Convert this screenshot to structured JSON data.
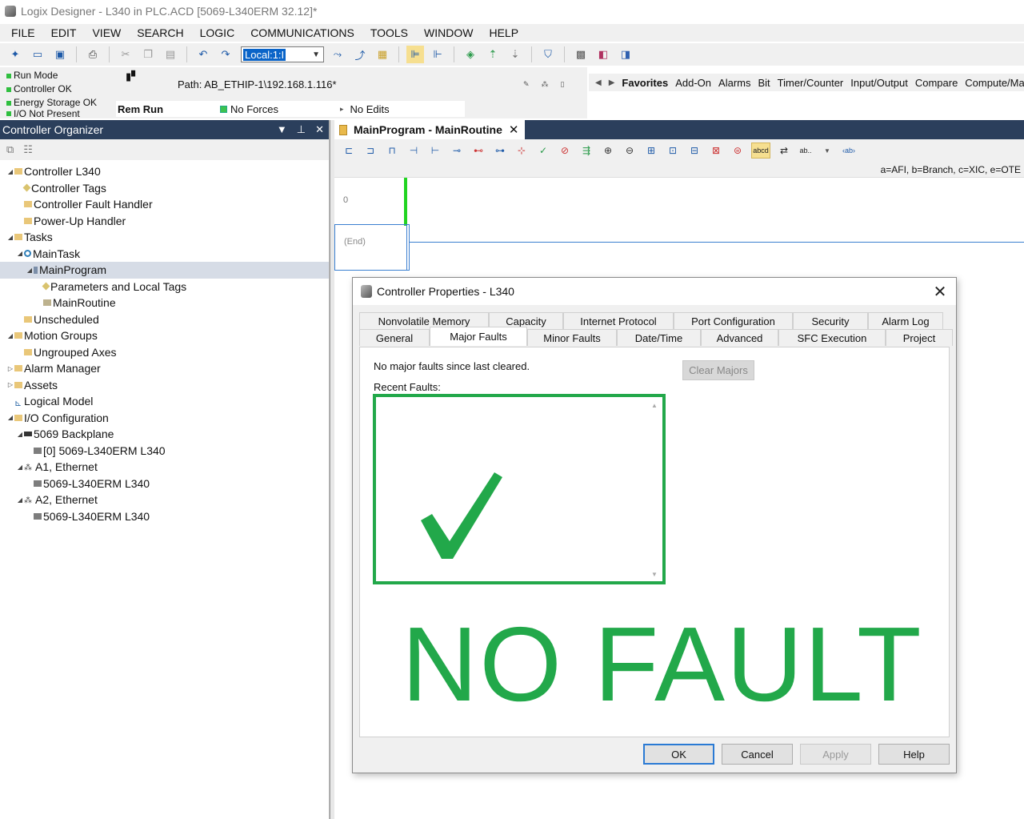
{
  "window": {
    "title": "Logix Designer - L340 in PLC.ACD [5069-L340ERM 32.12]*"
  },
  "menu": [
    "FILE",
    "EDIT",
    "VIEW",
    "SEARCH",
    "LOGIC",
    "COMMUNICATIONS",
    "TOOLS",
    "WINDOW",
    "HELP"
  ],
  "toolbar": {
    "path_combo_value": "Local:1:I"
  },
  "status": {
    "items": [
      "Run Mode",
      "Controller OK",
      "Energy Storage OK",
      "I/O Not Present"
    ],
    "path": "Path:  AB_ETHIP-1\\192.168.1.116*",
    "mode": "Rem Run",
    "forces": "No Forces",
    "edits": "No Edits"
  },
  "instruction_tabs": [
    "Favorites",
    "Add-On",
    "Alarms",
    "Bit",
    "Timer/Counter",
    "Input/Output",
    "Compare",
    "Compute/Math"
  ],
  "organizer": {
    "title": "Controller Organizer",
    "tree": [
      {
        "label": "Controller L340",
        "level": 0,
        "expander": "◢",
        "icon": "folder"
      },
      {
        "label": "Controller Tags",
        "level": 1,
        "expander": "",
        "icon": "tag"
      },
      {
        "label": "Controller Fault Handler",
        "level": 1,
        "expander": "",
        "icon": "folder"
      },
      {
        "label": "Power-Up Handler",
        "level": 1,
        "expander": "",
        "icon": "folder"
      },
      {
        "label": "Tasks",
        "level": 0,
        "expander": "◢",
        "icon": "folder"
      },
      {
        "label": "MainTask",
        "level": 1,
        "expander": "◢",
        "icon": "gear"
      },
      {
        "label": "MainProgram",
        "level": 2,
        "expander": "◢",
        "icon": "prog",
        "selected": true
      },
      {
        "label": "Parameters and Local Tags",
        "level": 3,
        "expander": "",
        "icon": "tag"
      },
      {
        "label": "MainRoutine",
        "level": 3,
        "expander": "",
        "icon": "routine"
      },
      {
        "label": "Unscheduled",
        "level": 1,
        "expander": "",
        "icon": "folder"
      },
      {
        "label": "Motion Groups",
        "level": 0,
        "expander": "◢",
        "icon": "folder"
      },
      {
        "label": "Ungrouped Axes",
        "level": 1,
        "expander": "",
        "icon": "folder"
      },
      {
        "label": "Alarm Manager",
        "level": 0,
        "expander": "▷",
        "icon": "folder"
      },
      {
        "label": "Assets",
        "level": 0,
        "expander": "▷",
        "icon": "folder"
      },
      {
        "label": "Logical Model",
        "level": 0,
        "expander": "",
        "icon": "model"
      },
      {
        "label": "I/O Configuration",
        "level": 0,
        "expander": "◢",
        "icon": "folder"
      },
      {
        "label": "5069 Backplane",
        "level": 1,
        "expander": "◢",
        "icon": "backplane"
      },
      {
        "label": "[0] 5069-L340ERM L340",
        "level": 2,
        "expander": "",
        "icon": "module"
      },
      {
        "label": "A1, Ethernet",
        "level": 1,
        "expander": "◢",
        "icon": "net"
      },
      {
        "label": "5069-L340ERM L340",
        "level": 2,
        "expander": "",
        "icon": "module"
      },
      {
        "label": "A2, Ethernet",
        "level": 1,
        "expander": "◢",
        "icon": "net"
      },
      {
        "label": "5069-L340ERM L340",
        "level": 2,
        "expander": "",
        "icon": "module"
      }
    ]
  },
  "editor": {
    "tab_label": "MainProgram - MainRoutine",
    "mnemonic_hint": "a=AFI, b=Branch, c=XIC, e=OTE",
    "rung_number": "0",
    "end_label": "(End)"
  },
  "dialog": {
    "title": "Controller Properties - L340",
    "tabs_row1": [
      "Nonvolatile Memory",
      "Capacity",
      "Internet Protocol",
      "Port Configuration",
      "Security",
      "Alarm Log"
    ],
    "tabs_row2": [
      "General",
      "Major Faults",
      "Minor Faults",
      "Date/Time",
      "Advanced",
      "SFC Execution",
      "Project"
    ],
    "active_tab": "Major Faults",
    "no_faults_msg": "No major faults since last cleared.",
    "clear_button": "Clear Majors",
    "recent_label": "Recent Faults:",
    "overlay_text": "NO FAULT",
    "buttons": {
      "ok": "OK",
      "cancel": "Cancel",
      "apply": "Apply",
      "help": "Help"
    },
    "accent_color": "#22a84a"
  }
}
